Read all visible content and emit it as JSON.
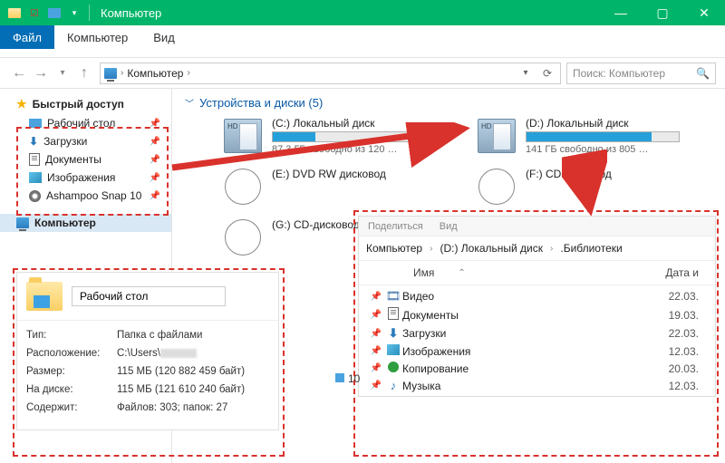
{
  "window": {
    "title": "Компьютер",
    "controls": {
      "min": "—",
      "max": "▢",
      "close": "✕"
    }
  },
  "menu": {
    "file": "Файл",
    "computer": "Компьютер",
    "view": "Вид"
  },
  "addressbar": {
    "location": "Компьютер",
    "search_placeholder": "Поиск: Компьютер"
  },
  "sidebar": {
    "quick_access": "Быстрый доступ",
    "items": [
      {
        "label": "Рабочий стол",
        "icon": "desk"
      },
      {
        "label": "Загрузки",
        "icon": "dl"
      },
      {
        "label": "Документы",
        "icon": "doc"
      },
      {
        "label": "Изображения",
        "icon": "img"
      },
      {
        "label": "Ashampoo Snap 10",
        "icon": "ashampoo"
      }
    ],
    "computer": "Компьютер"
  },
  "section": {
    "title": "Устройства и диски (5)"
  },
  "drives": [
    {
      "name": "(C:) Локальный диск",
      "free": "87,3 ГБ свободно из 120 …",
      "fill_pct": 28,
      "type": "hdd"
    },
    {
      "name": "(D:) Локальный диск",
      "free": "141 ГБ свободно из 805 …",
      "fill_pct": 82,
      "type": "hdd"
    },
    {
      "name": "(E:) DVD RW дисковод",
      "type": "cd"
    },
    {
      "name": "(F:) CD-дисковод",
      "type": "cd"
    },
    {
      "name": "(G:) CD-дисковод",
      "type": "cd"
    }
  ],
  "props": {
    "name_value": "Рабочий стол",
    "rows": [
      {
        "label": "Тип:",
        "value": "Папка с файлами"
      },
      {
        "label": "Расположение:",
        "value": "C:\\Users\\",
        "blurred_tail": true
      },
      {
        "label": "Размер:",
        "value": "115 МБ (120 882 459 байт)"
      },
      {
        "label": "На диске:",
        "value": "115 МБ (121 610 240 байт)"
      },
      {
        "label": "Содержит:",
        "value": "Файлов: 303; папок: 27"
      }
    ]
  },
  "lib": {
    "tabs": {
      "share": "Поделиться",
      "view": "Вид"
    },
    "crumbs": [
      "Компьютер",
      "(D:) Локальный диск",
      ".Библиотеки"
    ],
    "col_name": "Имя",
    "col_date": "Дата и",
    "sort_indicator": "⌃",
    "count": "10",
    "items": [
      {
        "icon": "video",
        "name": "Видео",
        "date": "22.03."
      },
      {
        "icon": "doc",
        "name": "Документы",
        "date": "19.03."
      },
      {
        "icon": "dl",
        "name": "Загрузки",
        "date": "22.03."
      },
      {
        "icon": "img",
        "name": "Изображения",
        "date": "12.03."
      },
      {
        "icon": "dot",
        "name": "Копирование",
        "date": "20.03."
      },
      {
        "icon": "music",
        "name": "Музыка",
        "date": "12.03."
      }
    ]
  }
}
